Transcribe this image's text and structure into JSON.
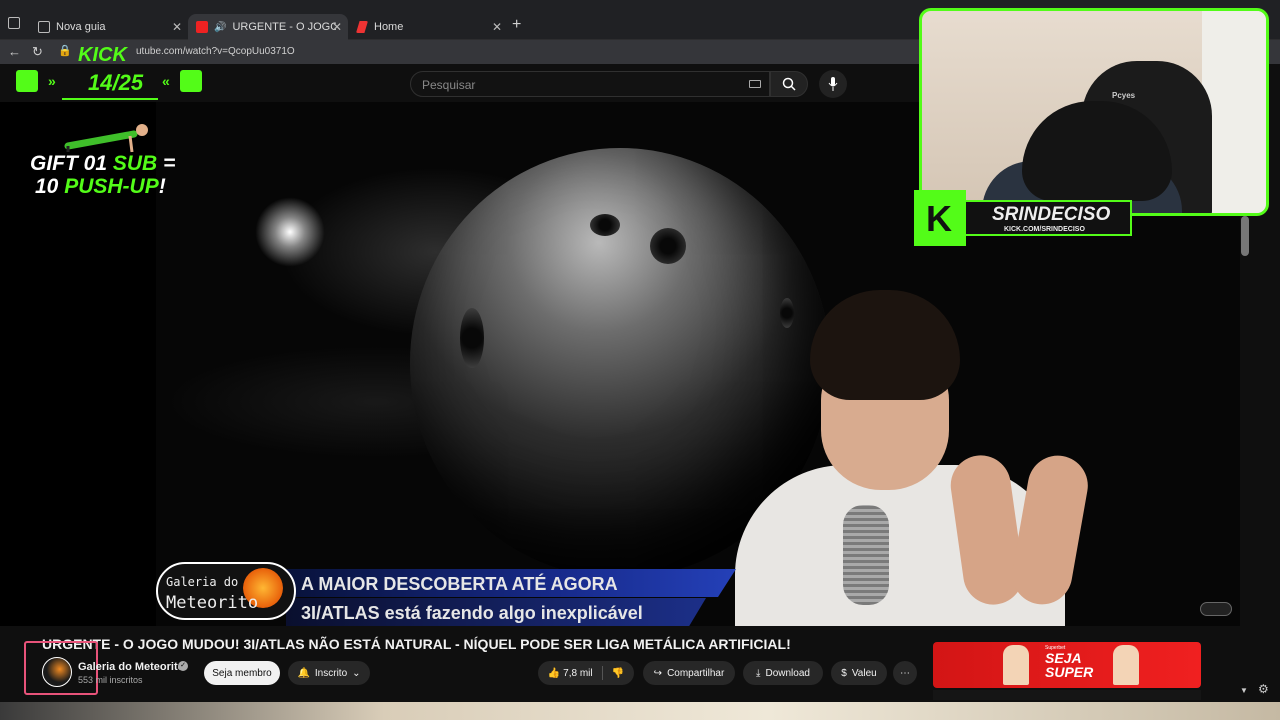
{
  "browser": {
    "tabs": [
      {
        "label": "Nova guia"
      },
      {
        "label": "URGENTE - O JOGO MUDOU"
      },
      {
        "label": "Home"
      }
    ],
    "url": "utube.com/watch?v=QcopUu0371O"
  },
  "search": {
    "placeholder": "Pesquisar"
  },
  "kick_goal": {
    "title": "KICK",
    "count": "14/25"
  },
  "gift": {
    "w1": "GIFT",
    "g1": "01",
    "g2": "SUB",
    "w2": "=",
    "w3": "10",
    "g3": "PUSH-UP",
    "w4": "!"
  },
  "streamer_badge": {
    "name": "SRINDECISO",
    "url": "KICK.COM/SRINDECISO"
  },
  "webcam": {
    "chair_brand": "Pcyes"
  },
  "video_overlay": {
    "logo_line1": "Galeria do",
    "logo_line2": "Meteorito",
    "headline": "A MAIOR DESCOBERTA ATÉ AGORA",
    "subheadline": "3I/ATLAS está fazendo algo inexplicável"
  },
  "video": {
    "title": "URGENTE - O JOGO MUDOU! 3I/ATLAS NÃO ESTÁ NATURAL - NÍQUEL PODE SER LIGA METÁLICA ARTIFICIAL!",
    "channel": "Galeria do Meteorito",
    "subscribers": "553 mil inscritos"
  },
  "actions": {
    "join": "Seja membro",
    "subscribed": "Inscrito",
    "likes": "7,8 mil",
    "share": "Compartilhar",
    "download": "Download",
    "thanks": "Valeu",
    "more": "⋯"
  },
  "ad": {
    "small": "Superbet",
    "big1": "SEJA",
    "big2": "SUPER"
  },
  "colors": {
    "kick_green": "#53fc18",
    "yt_bg": "#0f0f0f",
    "ad_red": "#e01818"
  }
}
